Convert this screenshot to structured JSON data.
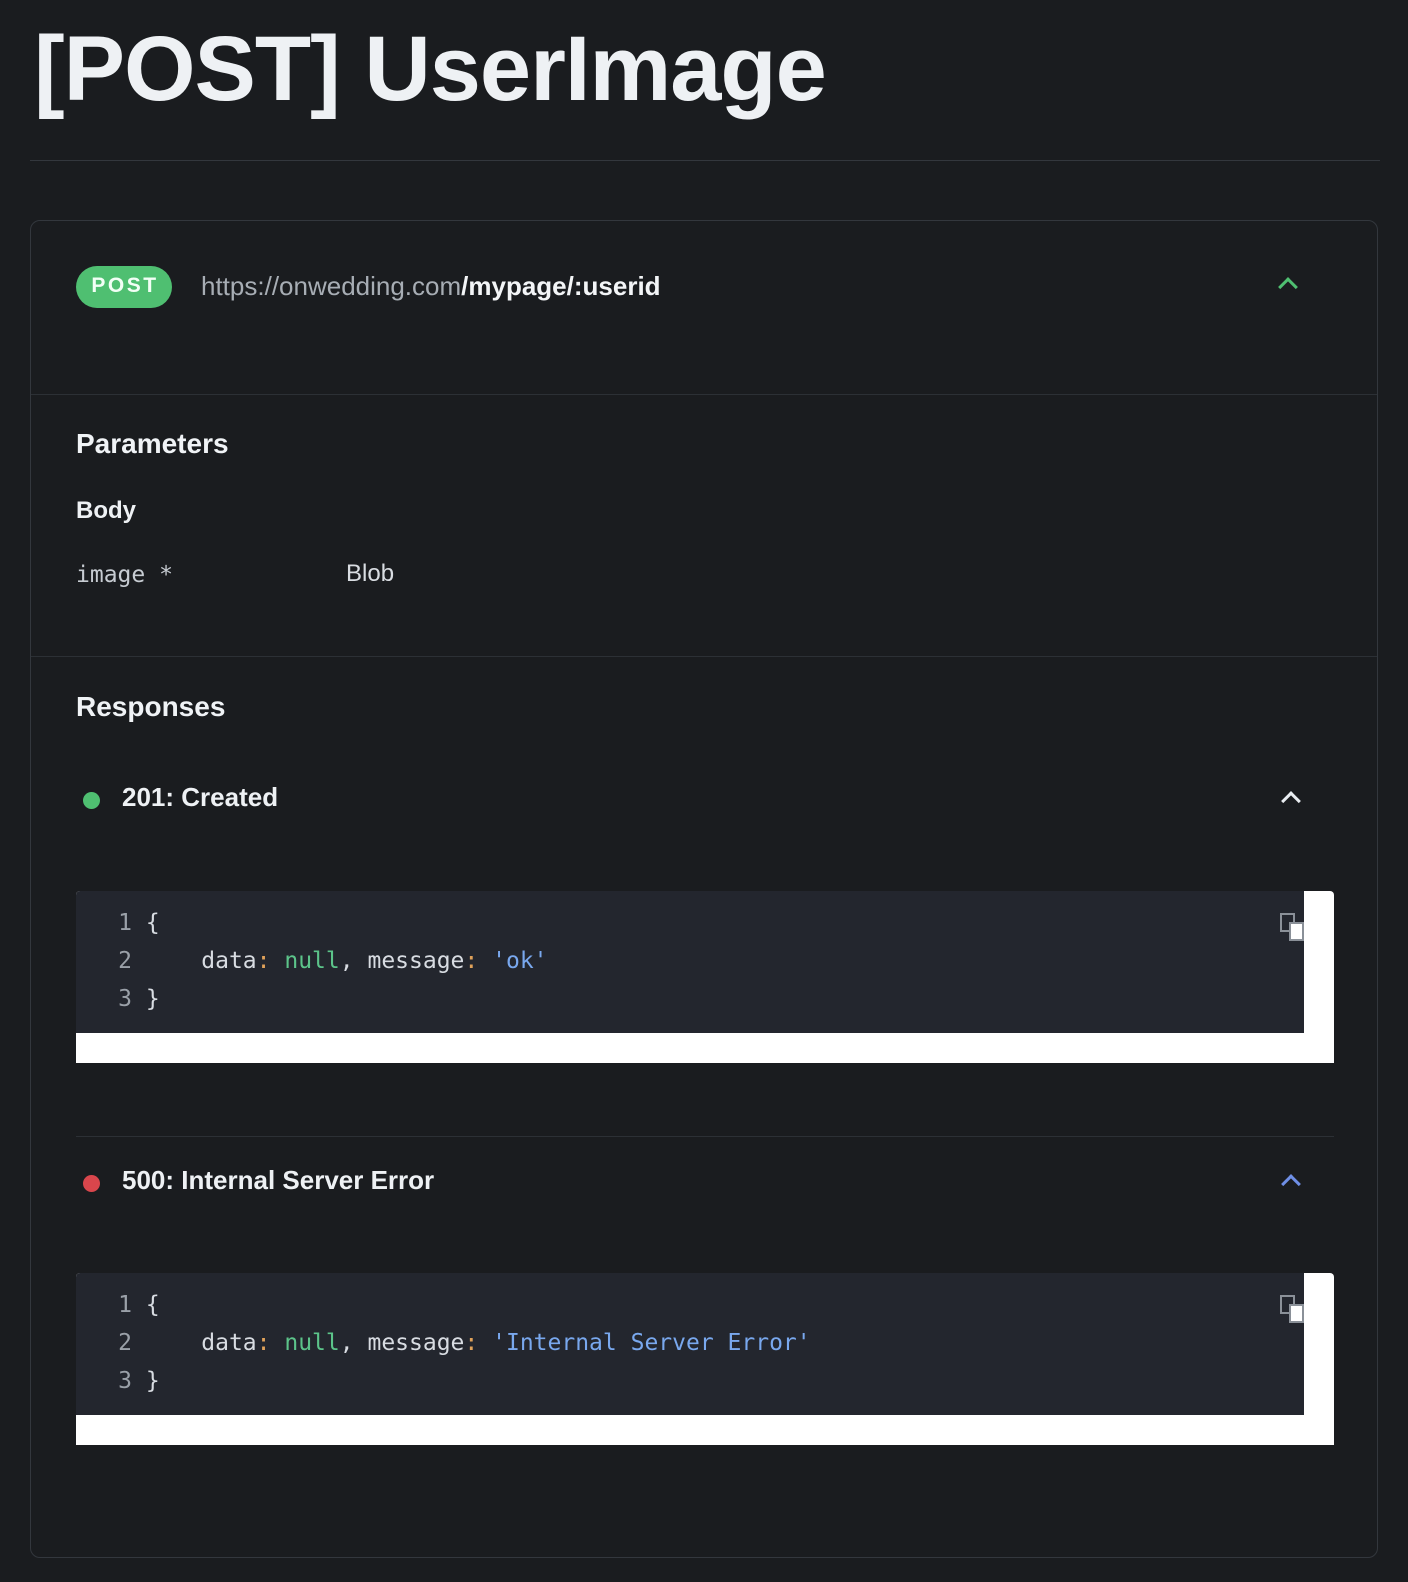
{
  "page": {
    "title": "[POST] UserImage"
  },
  "endpoint": {
    "method": "POST",
    "url_base": "https://onwedding.com",
    "url_path": "/mypage/:userid",
    "method_color": "#4fbf71"
  },
  "parameters": {
    "title": "Parameters",
    "body_title": "Body",
    "items": [
      {
        "name": "image *",
        "type": "Blob"
      }
    ]
  },
  "responses": {
    "title": "Responses",
    "items": [
      {
        "status": "201: Created",
        "dot_color": "#4fbf71",
        "chevron_color": "#e9edf1",
        "code": {
          "line_numbers": [
            "1",
            "2",
            "3"
          ],
          "open_brace": "{",
          "key_data": "data",
          "colon": ":",
          "null_value": "null",
          "comma": ",",
          "key_message": "message",
          "message_value": "'ok'",
          "close_brace": "}"
        }
      },
      {
        "status": "500: Internal Server Error",
        "dot_color": "#d9464c",
        "chevron_color": "#6f8fe6",
        "code": {
          "line_numbers": [
            "1",
            "2",
            "3"
          ],
          "open_brace": "{",
          "key_data": "data",
          "colon": ":",
          "null_value": "null",
          "comma": ",",
          "key_message": "message",
          "message_value": "'Internal Server Error'",
          "close_brace": "}"
        }
      }
    ]
  },
  "icons": {
    "expand_collapse": "chevron-up-icon",
    "copy": "copy-icon",
    "status": "status-dot-icon"
  }
}
